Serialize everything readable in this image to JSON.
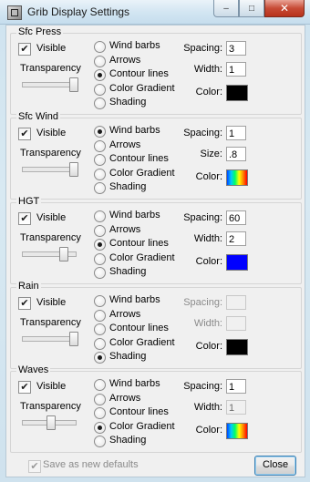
{
  "window": {
    "title": "Grib Display Settings",
    "caption_min": "–",
    "caption_max": "□",
    "caption_close": "✕"
  },
  "groups": [
    {
      "name": "Sfc Press",
      "visible_label": "Visible",
      "visible_checked": true,
      "transparency_label": "Transparency",
      "transparency": 1.0,
      "options": [
        "Wind barbs",
        "Arrows",
        "Contour lines",
        "Color Gradient",
        "Shading"
      ],
      "selected": "Contour lines",
      "field1_label": "Spacing:",
      "field1_value": "3",
      "field2_label": "Width:",
      "field2_value": "1",
      "fields_enabled": true,
      "color_label": "Color:",
      "color": "#000000",
      "gradient": false
    },
    {
      "name": "Sfc Wind",
      "visible_label": "Visible",
      "visible_checked": true,
      "transparency_label": "Transparency",
      "transparency": 1.0,
      "options": [
        "Wind barbs",
        "Arrows",
        "Contour lines",
        "Color Gradient",
        "Shading"
      ],
      "selected": "Wind barbs",
      "field1_label": "Spacing:",
      "field1_value": "1",
      "field2_label": "Size:",
      "field2_value": ".8",
      "fields_enabled": true,
      "color_label": "Color:",
      "color": "gradient",
      "gradient": true
    },
    {
      "name": "HGT",
      "visible_label": "Visible",
      "visible_checked": true,
      "transparency_label": "Transparency",
      "transparency": 0.78,
      "options": [
        "Wind barbs",
        "Arrows",
        "Contour lines",
        "Color Gradient",
        "Shading"
      ],
      "selected": "Contour lines",
      "field1_label": "Spacing:",
      "field1_value": "60",
      "field2_label": "Width:",
      "field2_value": "2",
      "fields_enabled": true,
      "color_label": "Color:",
      "color": "#0000ff",
      "gradient": false
    },
    {
      "name": "Rain",
      "visible_label": "Visible",
      "visible_checked": true,
      "transparency_label": "Transparency",
      "transparency": 1.0,
      "options": [
        "Wind barbs",
        "Arrows",
        "Contour lines",
        "Color Gradient",
        "Shading"
      ],
      "selected": "Shading",
      "field1_label": "Spacing:",
      "field1_value": "",
      "field2_label": "Width:",
      "field2_value": "",
      "fields_enabled": false,
      "color_label": "Color:",
      "color": "#000000",
      "gradient": false
    },
    {
      "name": "Waves",
      "visible_label": "Visible",
      "visible_checked": true,
      "transparency_label": "Transparency",
      "transparency": 0.52,
      "options": [
        "Wind barbs",
        "Arrows",
        "Contour lines",
        "Color Gradient",
        "Shading"
      ],
      "selected": "Color Gradient",
      "field1_label": "Spacing:",
      "field1_value": "1",
      "field2_label": "Width:",
      "field2_value": "1",
      "fields_enabled": true,
      "field2_enabled": false,
      "color_label": "Color:",
      "color": "gradient",
      "gradient": true
    }
  ],
  "footer": {
    "save_defaults_label": "Save as new defaults",
    "save_defaults_checked": true,
    "close_label": "Close"
  }
}
